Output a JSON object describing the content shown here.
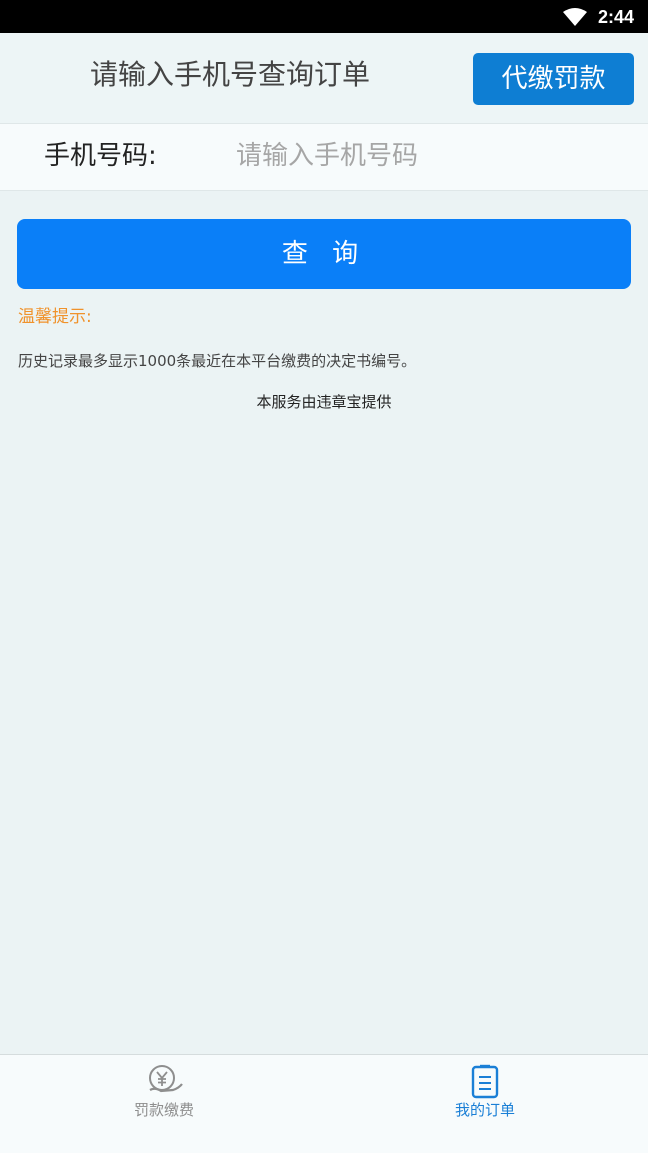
{
  "status_bar": {
    "time": "2:44",
    "wifi_icon": "wifi-icon"
  },
  "header": {
    "title": "请输入手机号查询订单",
    "pay_button_label": "代缴罚款"
  },
  "phone_field": {
    "label": "手机号码:",
    "value": "",
    "placeholder": "请输入手机号码"
  },
  "query_button_label": "查 询",
  "tips": {
    "title": "温馨提示:",
    "text": "历史记录最多显示1000条最近在本平台缴费的决定书编号。"
  },
  "provider_text": "本服务由违章宝提供",
  "tabbar": {
    "tabs": [
      {
        "label": "罚款缴费",
        "icon": "yuan-hand-icon",
        "active": false
      },
      {
        "label": "我的订单",
        "icon": "clipboard-list-icon",
        "active": true
      }
    ]
  },
  "colors": {
    "background": "#ebf3f4",
    "primary_button": "#0a7ff8",
    "header_button": "#0e7ed3",
    "tip_title": "#f0922b",
    "active_tab": "#1a7fd6",
    "inactive_tab": "#8e8e8e"
  }
}
